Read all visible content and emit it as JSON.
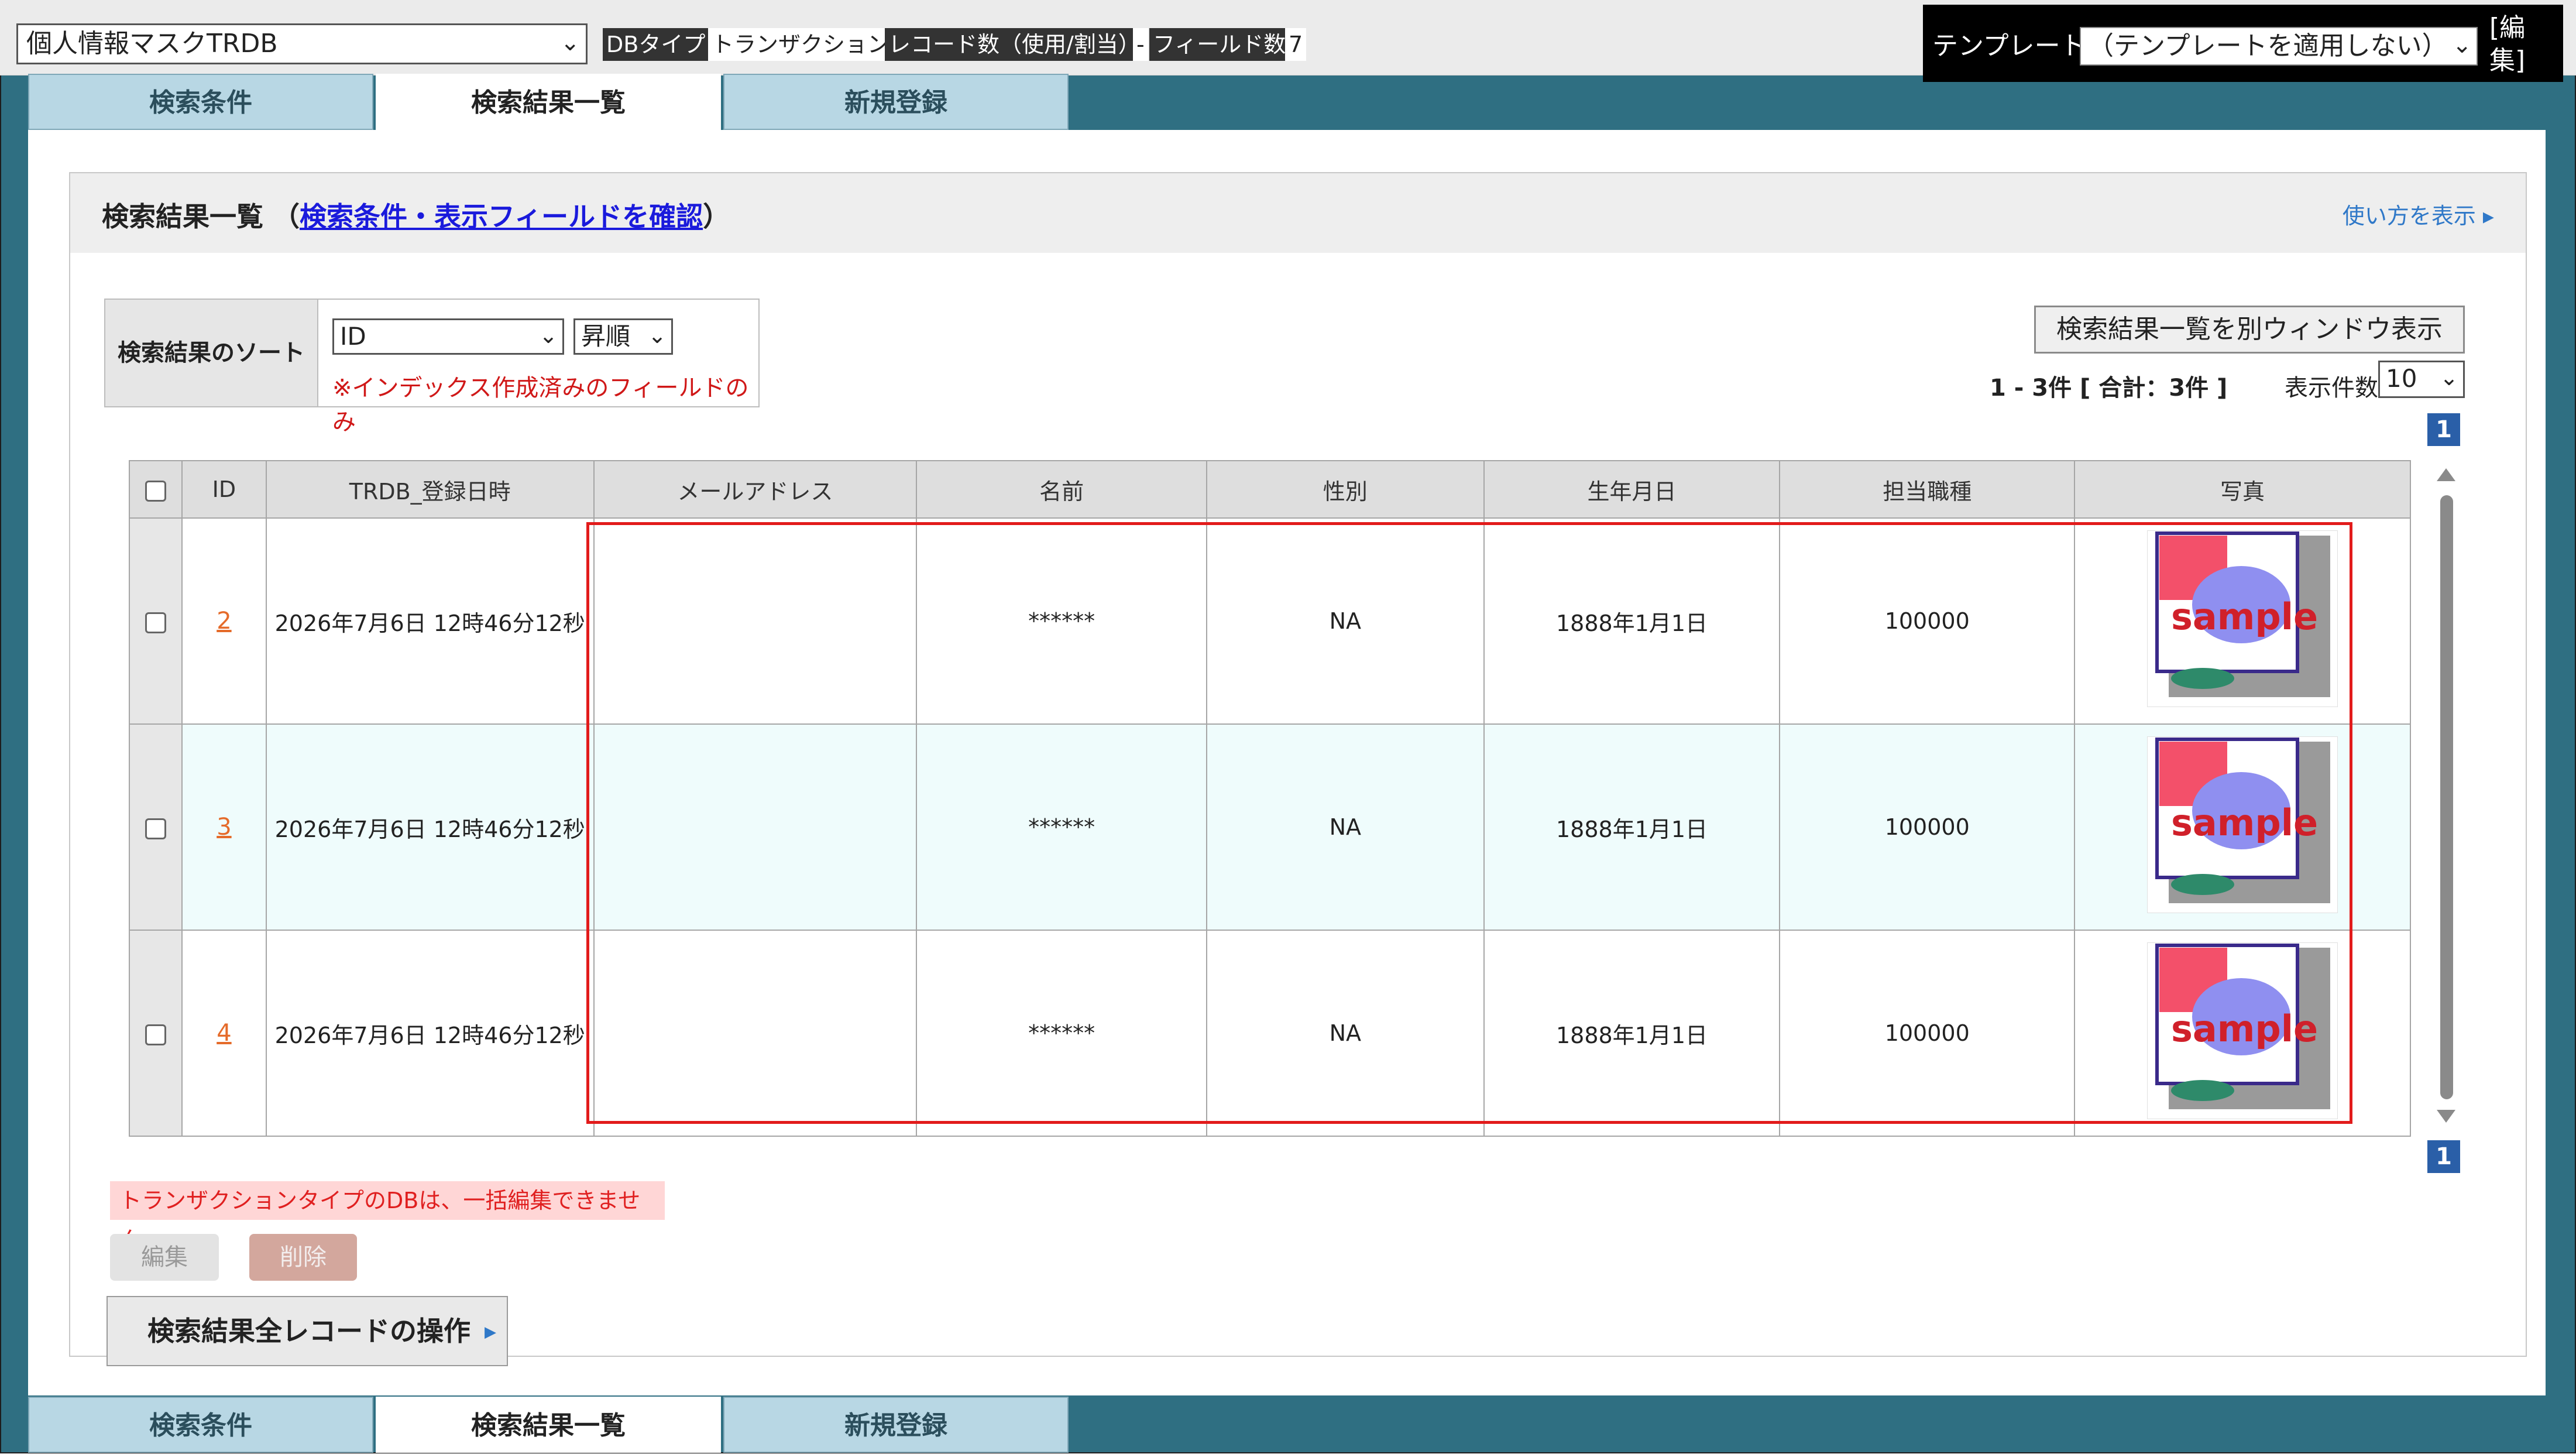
{
  "topbar": {
    "db_select_value": "個人情報マスクTRDB",
    "db_type_label": "DBタイプ",
    "db_type_value": "トランザクション",
    "record_count_label": "レコード数（使用/割当）",
    "record_count_value": "-",
    "field_count_label": "フィールド数",
    "field_count_value": "7",
    "template_label": "テンプレート",
    "template_select_value": "（テンプレートを適用しない）",
    "template_edit_link": "[編集]"
  },
  "tabs": {
    "search_conditions": "検索条件",
    "search_results": "検索結果一覧",
    "new_registration": "新規登録",
    "active": "検索結果一覧"
  },
  "header": {
    "title": "検索結果一覧",
    "paren_open": "（",
    "confirm_link": "検索条件・表示フィールドを確認",
    "paren_close": "）",
    "howto": "使い方を表示 ▸"
  },
  "sort": {
    "label": "検索結果のソート",
    "field_value": "ID",
    "order_value": "昇順",
    "note": "※インデックス作成済みのフィールドのみ"
  },
  "results": {
    "open_window_button": "検索結果一覧を別ウィンドウ表示",
    "count_text": "1 - 3件 [ 合計：3件 ]",
    "per_page_label": "表示件数",
    "per_page_value": "10",
    "page_number": "1"
  },
  "table": {
    "headers": [
      "ID",
      "TRDB_登録日時",
      "メールアドレス",
      "名前",
      "性別",
      "生年月日",
      "担当職種",
      "写真"
    ],
    "rows": [
      {
        "id": "2",
        "registered_at": "2026年7月6日 12時46分12秒",
        "email": "",
        "name": "******",
        "gender": "NA",
        "birthdate": "1888年1月1日",
        "job": "100000",
        "photo_text": "sample"
      },
      {
        "id": "3",
        "registered_at": "2026年7月6日 12時46分12秒",
        "email": "",
        "name": "******",
        "gender": "NA",
        "birthdate": "1888年1月1日",
        "job": "100000",
        "photo_text": "sample"
      },
      {
        "id": "4",
        "registered_at": "2026年7月6日 12時46分12秒",
        "email": "",
        "name": "******",
        "gender": "NA",
        "birthdate": "1888年1月1日",
        "job": "100000",
        "photo_text": "sample"
      }
    ]
  },
  "actions": {
    "warning": "トランザクションタイプのDBは、一括編集できません。",
    "edit_button": "編集",
    "delete_button": "削除",
    "all_records_button": "検索結果全レコードの操作"
  },
  "colors": {
    "frame": "#2f6f82",
    "tab_inactive": "#b8d7e4",
    "link": "#1a1adc",
    "id_link": "#e56b2a",
    "highlight_box": "#e21b1b",
    "page_badge": "#2a5fa8"
  }
}
